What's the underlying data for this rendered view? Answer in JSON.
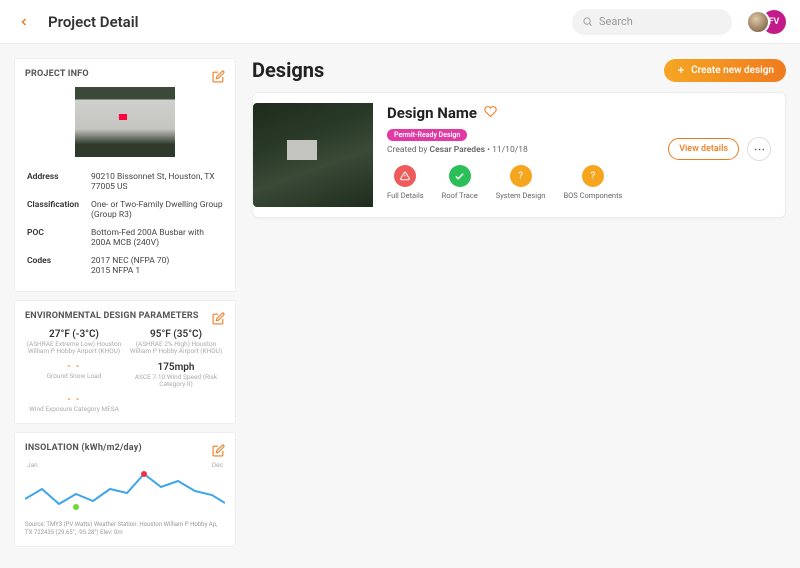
{
  "header": {
    "title": "Project Detail",
    "search_placeholder": "Search",
    "avatar2_initials": "FV"
  },
  "project_info": {
    "card_title": "PROJECT INFO",
    "rows": {
      "address_label": "Address",
      "address_value": "90210 Bissonnet St, Houston, TX 77005 US",
      "classification_label": "Classification",
      "classification_value": "One- or Two-Family Dwelling Group (Group R3)",
      "poc_label": "POC",
      "poc_value": "Bottom-Fed 200A Busbar with 200A MCB (240V)",
      "codes_label": "Codes",
      "codes_value": "2017 NEC (NFPA 70)\n2015 NFPA 1"
    }
  },
  "env": {
    "card_title": "ENVIRONMENTAL DESIGN PARAMETERS",
    "temp_low_val": "27°F (-3°C)",
    "temp_low_lab": "(ASHRAE Extreme Low) Houston William P Hobby Airport (KHOU)",
    "temp_high_val": "95°F (35°C)",
    "temp_high_lab": "(ASHRAE 2% High) Houston William P Hobby Airport (KHOU)",
    "snow_val": "- -",
    "snow_lab": "Ground Snow Load",
    "wind_val": "175mph",
    "wind_lab": "ASCE 7-10 Wind Speed (Risk Category II)",
    "exposure_val": "- -",
    "exposure_lab": "Wind Exposure Category MESA"
  },
  "insolation": {
    "card_title": "INSOLATION (kWh/m2/day)",
    "label_start": "Jan",
    "label_end": "Dec",
    "source": "Source: TMY3 (PV Watts) Weather Station: Houston William P Hobby Ap, TX 722435 (29.65°, -95.28°) Elev: 0m"
  },
  "designs": {
    "section_title": "Designs",
    "create_label": "Create new design",
    "card": {
      "name": "Design Name",
      "badge": "Permit-Ready Design",
      "created_prefix": "Created by ",
      "created_author": "Cesar Paredes",
      "created_date": "11/10/18",
      "steps": {
        "full_details": "Full Details",
        "roof_trace": "Roof Trace",
        "system_design": "System Design",
        "bos": "BOS Components"
      },
      "view_label": "View details"
    }
  }
}
